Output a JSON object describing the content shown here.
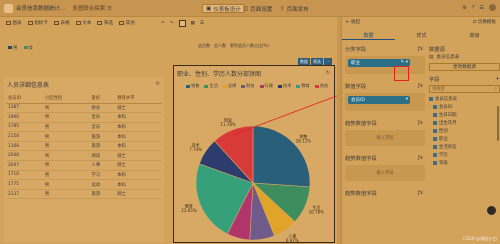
{
  "colors": {
    "background": "#d4a35b",
    "primary_pill": "#2b6f86",
    "highlight": "#e2231a",
    "tab_active": "#244d7c"
  },
  "topbar": {
    "title": "会员信息数据统计...",
    "subtitle": "多图联合探索 ☰",
    "modes": [
      "仪表板设计",
      "页面设置",
      "页面发布"
    ],
    "right_items": [
      "⚙",
      "?",
      "☰"
    ]
  },
  "toolbar": {
    "items": [
      "图表",
      "指标卡",
      "表格",
      "文本",
      "筛选",
      "其他"
    ],
    "icons": [
      "chart-icon",
      "kpi-card-icon",
      "table-icon",
      "text-icon",
      "filter-icon",
      "more-icon"
    ]
  },
  "top_legend": [
    {
      "label": "男",
      "color": "#27495e"
    },
    {
      "label": "女",
      "color": "#3d8d6a"
    }
  ],
  "top_right_legend": [
    "会员数",
    "总人数",
    "累积会员人数占比(%)"
  ],
  "table": {
    "title": "人员详细信息表",
    "headers": [
      "会员ID",
      "小区性别",
      "爱好",
      "教育水平"
    ],
    "rows": [
      [
        "1287",
        "男",
        "财会",
        "硕士"
      ],
      [
        "1900",
        "男",
        "音乐",
        "本科"
      ],
      [
        "1785",
        "男",
        "音乐",
        "本科"
      ],
      [
        "2158",
        "男",
        "旅游",
        "本科"
      ],
      [
        "1168",
        "男",
        "旅游",
        "本科"
      ],
      [
        "2048",
        "男",
        "阅读",
        "硕士"
      ],
      [
        "2047",
        "男",
        "人事",
        "硕士"
      ],
      [
        "1710",
        "男",
        "学习",
        "本科"
      ],
      [
        "1775",
        "男",
        "运动",
        "本科"
      ],
      [
        "2137",
        "男",
        "旅游",
        "硕士"
      ]
    ]
  },
  "chart_card": {
    "title": "职业、性别、学历人数分部饼图",
    "tools": [
      "数据",
      "筛选",
      "⋯"
    ]
  },
  "chart_data": {
    "type": "pie",
    "title": "职业、性别、学历人数分部饼图",
    "legend": [
      "销售",
      "生活",
      "法律",
      "财务",
      "行政",
      "技术",
      "教育",
      "其他"
    ],
    "slices": [
      {
        "name": "销售",
        "value": 26.11,
        "label": "销售\n26.11%",
        "color": "#2a5f7a"
      },
      {
        "name": "生活",
        "value": 10.78,
        "label": "生活\n10.78%",
        "color": "#3e8d5f"
      },
      {
        "name": "人事",
        "value": 6.97,
        "label": "人事\n6.97%",
        "color": "#e0a428"
      },
      {
        "name": "法律",
        "value": 7.07,
        "label": "",
        "color": "#6f5b8a"
      },
      {
        "name": "行政",
        "value": 6.5,
        "label": "",
        "color": "#b0356a"
      },
      {
        "name": "教育",
        "value": 23.05,
        "label": "教育\n23.05%",
        "color": "#35a07a"
      },
      {
        "name": "技术",
        "value": 7.74,
        "label": "技术\n7.74%",
        "color": "#2c3c6c"
      },
      {
        "name": "财会",
        "value": 11.78,
        "label": "财会\n11.78%",
        "color": "#d83a3a"
      }
    ]
  },
  "panel": {
    "header_left": "收起",
    "header_right": "切换模板",
    "tabs": [
      "数据",
      "样式",
      "高级"
    ],
    "sections_a": [
      {
        "title": "分类字段",
        "pill": "职业"
      },
      {
        "title": "数值字段",
        "pill": "会员ID"
      },
      {
        "title": "趋势数值字段",
        "pill": ""
      },
      {
        "title": "趋势数值字段",
        "pill": ""
      },
      {
        "title": "趋势数值字段",
        "pill": ""
      }
    ],
    "drop_hint": "拖入字段",
    "datasource": {
      "title": "数据源",
      "dataset": "会员信息表",
      "change_btn": "更改数据源",
      "fields_title": "字段",
      "search_placeholder": "请搜索",
      "tree": [
        "会员信息表",
        "会员ID",
        "生日日期",
        "出生年月",
        "性别",
        "职业",
        "生活状态",
        "学历",
        "等级"
      ]
    }
  },
  "watermark": "CSDN @编程小白"
}
